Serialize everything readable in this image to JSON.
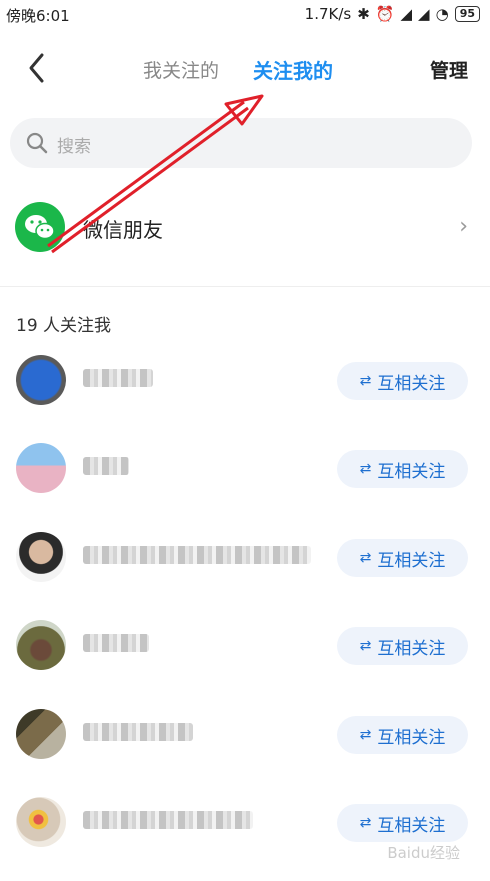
{
  "status_bar": {
    "time": "傍晚6:01",
    "net_speed": "1.7K/s",
    "battery": "95"
  },
  "header": {
    "tab_following": "我关注的",
    "tab_followers": "关注我的",
    "manage": "管理"
  },
  "search": {
    "placeholder": "搜索"
  },
  "wechat_friends": {
    "label": "微信朋友"
  },
  "followers_count": "19 人关注我",
  "followers": [
    {
      "button": "互相关注",
      "avatar_color": "#2a6ad1"
    },
    {
      "button": "互相关注",
      "avatar_color": "#e9b3c4"
    },
    {
      "button": "互相关注",
      "avatar_color": "#2b2b2b"
    },
    {
      "button": "互相关注",
      "avatar_color": "#6b6a3e"
    },
    {
      "button": "互相关注",
      "avatar_color": "#7b6b4a"
    },
    {
      "button": "互相关注",
      "avatar_color": "#d7c9b8"
    }
  ],
  "watermark": "Baidu经验",
  "colors": {
    "accent": "#1e8ef0",
    "wechat": "#1bb74a",
    "arrow": "#e0202a"
  }
}
